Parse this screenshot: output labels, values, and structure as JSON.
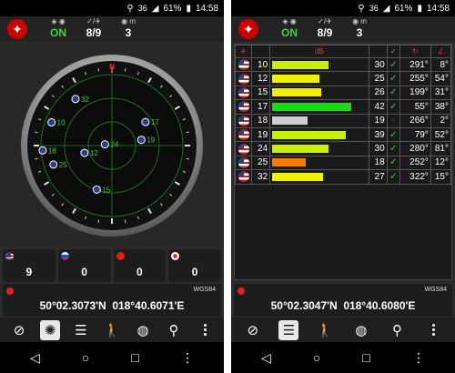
{
  "status": {
    "signal": "36",
    "battery": "61%",
    "time": "14:58"
  },
  "header": {
    "fix_status": "ON",
    "sats": "8/9",
    "count": "3"
  },
  "colors": {
    "ok": "#3fd13f",
    "flag_red": "#cc1f1f",
    "bar_green": "#10e010",
    "bar_yellowgreen": "#c8f000",
    "bar_yellow": "#f0f000",
    "bar_grey": "#cfcfcf",
    "bar_orange": "#ff7a00"
  },
  "compass": {
    "cardinal_N": "N",
    "satellites": [
      {
        "prn": "32",
        "az": 322,
        "el": 15
      },
      {
        "prn": "10",
        "az": 291,
        "el": 8
      },
      {
        "prn": "18",
        "az": 266,
        "el": 2
      },
      {
        "prn": "25",
        "az": 252,
        "el": 12
      },
      {
        "prn": "12",
        "az": 255,
        "el": 54
      },
      {
        "prn": "24",
        "az": 280,
        "el": 81
      },
      {
        "prn": "15",
        "az": 199,
        "el": 31
      },
      {
        "prn": "17",
        "az": 55,
        "el": 38
      },
      {
        "prn": "19",
        "az": 79,
        "el": 52
      }
    ]
  },
  "cards": [
    {
      "flag": "us",
      "value": "9"
    },
    {
      "flag": "ru",
      "value": "0"
    },
    {
      "flag": "cn",
      "value": "0"
    },
    {
      "flag": "jp",
      "value": "0"
    }
  ],
  "left_coords": {
    "datum": "WGS84",
    "lat": "50°02.3073'N",
    "lon": "018°40.6071'E"
  },
  "right_coords": {
    "datum": "WGS84",
    "lat": "50°02.3047'N",
    "lon": "018°40.6080'E"
  },
  "table": {
    "header_snr": "dB",
    "rows": [
      {
        "prn": "10",
        "snr": 30,
        "snr_label": "30",
        "used": "✓",
        "az": "291°",
        "el": "8°",
        "color": "bar_yellowgreen"
      },
      {
        "prn": "12",
        "snr": 25,
        "snr_label": "25",
        "used": "✓",
        "az": "255°",
        "el": "54°",
        "color": "bar_yellow"
      },
      {
        "prn": "15",
        "snr": 26,
        "snr_label": "26",
        "used": "✓",
        "az": "199°",
        "el": "31°",
        "color": "bar_yellow"
      },
      {
        "prn": "17",
        "snr": 42,
        "snr_label": "42",
        "used": "✓",
        "az": "55°",
        "el": "38°",
        "color": "bar_green"
      },
      {
        "prn": "18",
        "snr": 19,
        "snr_label": "19",
        "used": "-",
        "az": "266°",
        "el": "2°",
        "color": "bar_grey"
      },
      {
        "prn": "19",
        "snr": 39,
        "snr_label": "39",
        "used": "✓",
        "az": "79°",
        "el": "52°",
        "color": "bar_yellowgreen"
      },
      {
        "prn": "24",
        "snr": 30,
        "snr_label": "30",
        "used": "✓",
        "az": "280°",
        "el": "81°",
        "color": "bar_yellowgreen"
      },
      {
        "prn": "25",
        "snr": 18,
        "snr_label": "18",
        "used": "✓",
        "az": "252°",
        "el": "12°",
        "color": "bar_orange"
      },
      {
        "prn": "32",
        "snr": 27,
        "snr_label": "27",
        "used": "✓",
        "az": "322°",
        "el": "15°",
        "color": "bar_yellow"
      }
    ]
  },
  "icons": [
    "compass-icon",
    "radar-icon",
    "bars-icon",
    "walk-icon",
    "globe-icon",
    "location-pin-icon",
    "menu-icon"
  ]
}
